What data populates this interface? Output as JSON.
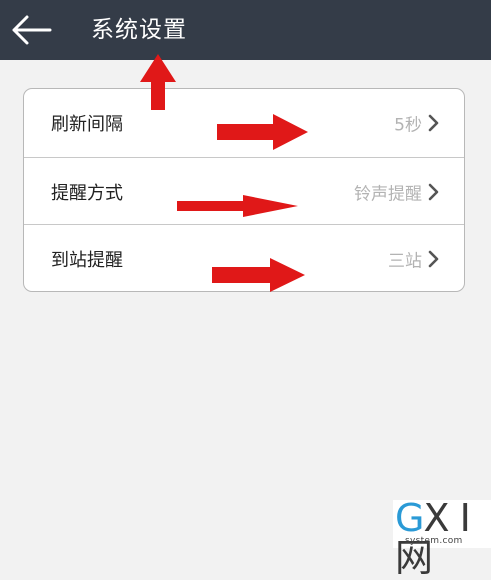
{
  "header": {
    "title": "系统设置",
    "back_icon": "back-arrow-icon",
    "background": "#343c48"
  },
  "settings": {
    "items": [
      {
        "label": "刷新间隔",
        "value": "5秒"
      },
      {
        "label": "提醒方式",
        "value": "铃声提醒"
      },
      {
        "label": "到站提醒",
        "value": "三站"
      }
    ],
    "chevron_icon": "chevron-right-icon"
  },
  "annotations": {
    "color": "#e01818"
  },
  "watermark": {
    "logo_g": "G",
    "logo_xi": "X I",
    "logo_wang": "网",
    "site": "system.com"
  }
}
